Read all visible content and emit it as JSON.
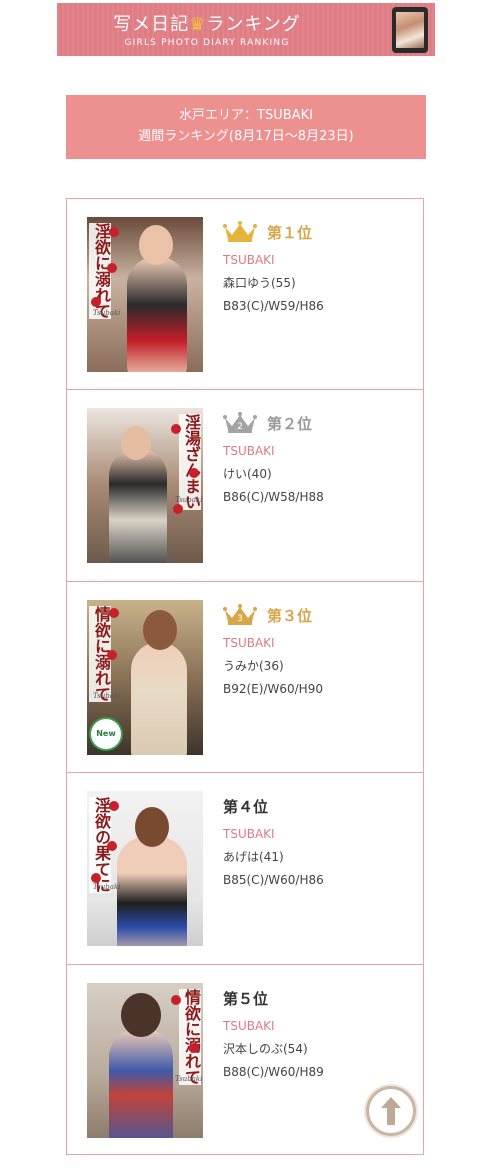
{
  "banner": {
    "title_pre": "写メ日記",
    "crown": "♛",
    "title_post": "ランキング",
    "subtitle": "GIRLS PHOTO DIARY RANKING"
  },
  "period": {
    "line1": "水戸エリア：TSUBAKI",
    "line2": "週間ランキング(8月17日〜8月23日)"
  },
  "entries": [
    {
      "rank": "第１位",
      "shop": "TSUBAKI",
      "name": "森口ゆう(55)",
      "size": "B83(C)/W59/H86",
      "photo_text": "淫欲に溺れて",
      "crown": "gold",
      "crown_number": ""
    },
    {
      "rank": "第２位",
      "shop": "TSUBAKI",
      "name": "けい(40)",
      "size": "B86(C)/W58/H88",
      "photo_text": "淫湯ざんまい",
      "crown": "silver",
      "crown_number": "2"
    },
    {
      "rank": "第３位",
      "shop": "TSUBAKI",
      "name": "うみか(36)",
      "size": "B92(E)/W60/H90",
      "photo_text": "情欲に溺れて",
      "crown": "bronze",
      "crown_number": "3",
      "badge": "New"
    },
    {
      "rank": "第４位",
      "shop": "TSUBAKI",
      "name": "あげは(41)",
      "size": "B85(C)/W60/H86",
      "photo_text": "淫欲の果てに",
      "crown": "none"
    },
    {
      "rank": "第５位",
      "shop": "TSUBAKI",
      "name": "沢本しのぶ(54)",
      "size": "B88(C)/W60/H89",
      "photo_text": "情欲に溺れて",
      "crown": "none"
    }
  ],
  "photo_brand": "Tsubaki",
  "colors": {
    "accent": "#ec9090",
    "banner": "#e07c84",
    "shop_text": "#e07a86",
    "gold": "#e6b43a",
    "silver": "#a3a3a3",
    "bronze": "#d6a64a",
    "border": "#e9a5a5"
  }
}
